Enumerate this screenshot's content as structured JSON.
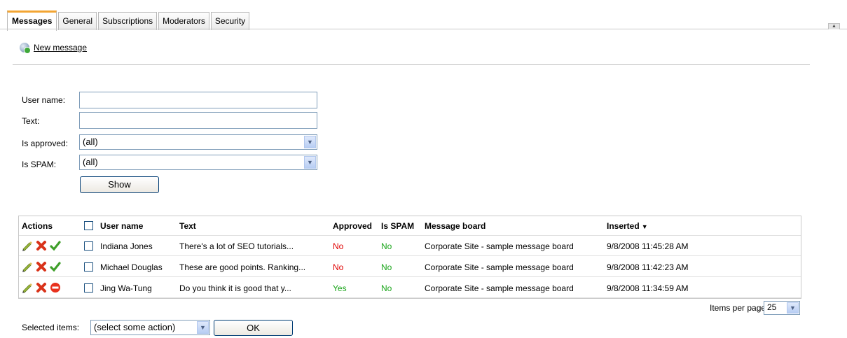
{
  "tabs": [
    "Messages",
    "General",
    "Subscriptions",
    "Moderators",
    "Security"
  ],
  "toolbar": {
    "new_message": "New message"
  },
  "filter": {
    "user_name_label": "User name:",
    "user_name_value": "",
    "text_label": "Text:",
    "text_value": "",
    "is_approved_label": "Is approved:",
    "is_approved_value": "(all)",
    "is_spam_label": "Is SPAM:",
    "is_spam_value": "(all)",
    "show_button": "Show"
  },
  "grid": {
    "columns": [
      "Actions",
      "User name",
      "Text",
      "Approved",
      "Is SPAM",
      "Message board",
      "Inserted"
    ],
    "sort_indicator": "▼",
    "rows": [
      {
        "user": "Indiana Jones",
        "text": "There's a lot of SEO tutorials...",
        "approved": "No",
        "spam": "No",
        "board": "Corporate Site - sample message board",
        "inserted": "9/8/2008 11:45:28 AM"
      },
      {
        "user": "Michael Douglas",
        "text": "These are good points. Ranking...",
        "approved": "No",
        "spam": "No",
        "board": "Corporate Site - sample message board",
        "inserted": "9/8/2008 11:42:23 AM"
      },
      {
        "user": "Jing Wa-Tung",
        "text": "Do you think it is good that y...",
        "approved": "Yes",
        "spam": "No",
        "board": "Corporate Site - sample message board",
        "inserted": "9/8/2008 11:34:59 AM"
      }
    ]
  },
  "pager": {
    "items_per_page_label": "Items per page:",
    "items_per_page_value": "25"
  },
  "bulk": {
    "label": "Selected items:",
    "action_value": "(select some action)",
    "ok_button": "OK"
  },
  "colors": {
    "active_tab_accent": "#f3a533",
    "no_color": "#e00000",
    "yes_color": "#1aa51a"
  }
}
